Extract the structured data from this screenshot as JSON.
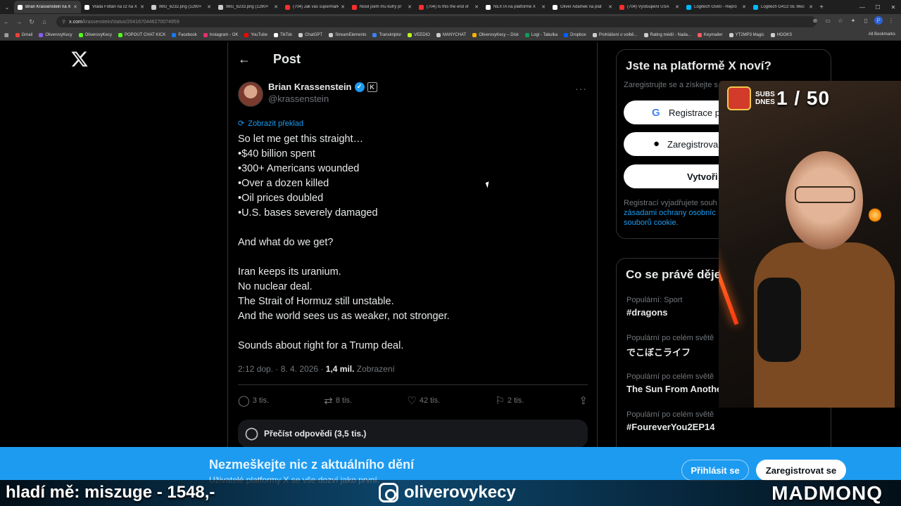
{
  "browser": {
    "tabs": [
      {
        "title": "Brian Krassenstein na X",
        "color": "#ffffff",
        "active": true
      },
      {
        "title": "Vláda Foltán na cz na X",
        "color": "#ffffff",
        "active": false
      },
      {
        "title": "IMG_6232.png (1290×",
        "color": "#cccccc",
        "active": false
      },
      {
        "title": "IMG_6233.png (1290×",
        "color": "#cccccc",
        "active": false
      },
      {
        "title": "(704) Jak vás supermark",
        "color": "#ff2d2d",
        "active": false
      },
      {
        "title": "Nosil jsem mu kufry pr",
        "color": "#ff2d2d",
        "active": false
      },
      {
        "title": "(704) Is this the end of",
        "color": "#ff2d2d",
        "active": false
      },
      {
        "title": "NEXTA na platformě X",
        "color": "#ffffff",
        "active": false
      },
      {
        "title": "Oliver Adámek na plat",
        "color": "#ffffff",
        "active": false
      },
      {
        "title": "(704) Vystoupení USA",
        "color": "#ff2d2d",
        "active": false
      },
      {
        "title": "Logitech G560 - Repro",
        "color": "#00b8fc",
        "active": false
      },
      {
        "title": "Logitech G413 SE Mec",
        "color": "#00b8fc",
        "active": false
      }
    ],
    "new_tab": "+",
    "url_host": "x.com",
    "url_path": "/krassenstein/status/2041670446270074959",
    "profile_letter": "P",
    "bookmarks": [
      {
        "label": "Gmail",
        "color": "#ea4335"
      },
      {
        "label": "OliverovyKecy",
        "color": "#8a5cf6"
      },
      {
        "label": "OliverovyKecy",
        "color": "#53fc18"
      },
      {
        "label": "POPOUT CHAT KICK",
        "color": "#53fc18"
      },
      {
        "label": "Facebook",
        "color": "#1877f2"
      },
      {
        "label": "Instagram - OK",
        "color": "#e1306c"
      },
      {
        "label": "YouTube",
        "color": "#ff0000"
      },
      {
        "label": "TikTok",
        "color": "#ffffff"
      },
      {
        "label": "ChatGPT",
        "color": "#cccccc"
      },
      {
        "label": "StreamElements",
        "color": "#cccccc"
      },
      {
        "label": "Transkriptor",
        "color": "#3b82f6"
      },
      {
        "label": "VEEDIO",
        "color": "#b9f227"
      },
      {
        "label": "MANYCHAT",
        "color": "#cccccc"
      },
      {
        "label": "OliverovyKecy – Disk",
        "color": "#f4b400"
      },
      {
        "label": "Logi - Tabulka",
        "color": "#0f9d58"
      },
      {
        "label": "Dropbox",
        "color": "#0061ff"
      },
      {
        "label": "Prohlášení o volbě...",
        "color": "#cccccc"
      },
      {
        "label": "Rating médií - Nada...",
        "color": "#cccccc"
      },
      {
        "label": "Keymailer",
        "color": "#ff5a5f"
      },
      {
        "label": "YT2MP3 Magic",
        "color": "#cccccc"
      },
      {
        "label": "HOOKS",
        "color": "#cccccc"
      }
    ],
    "all_bookmarks": "All Bookmarks"
  },
  "post": {
    "header_title": "Post",
    "author_name": "Brian Krassenstein",
    "author_handle": "@krassenstein",
    "affiliate_badge": "K",
    "translate_label": "Zobrazit překlad",
    "lines": [
      "So let me get this straight…",
      "•$40 billion spent",
      "•300+ Americans wounded",
      "•Over a dozen killed",
      "•Oil prices doubled",
      "•U.S. bases severely damaged",
      "",
      "And what do we get?",
      "",
      "Iran keeps its uranium.",
      "No nuclear deal.",
      "The Strait of Hormuz still unstable.",
      "And the world sees us as weaker, not stronger.",
      "",
      "Sounds about right for a Trump deal."
    ],
    "timestamp": "2:12 dop. · 8. 4. 2026 ·",
    "views_count": "1,4 mil.",
    "views_label": "Zobrazení",
    "replies": "3 tis.",
    "reposts": "8 tis.",
    "likes": "42 tis.",
    "bookmarks": "2 tis.",
    "read_replies": "Přečíst odpovědi (3,5 tis.)"
  },
  "sidebar": {
    "signup": {
      "title": "Jste na platformě X noví?",
      "subtitle": "Zaregistrujte se a získejte s",
      "google_btn": "Registrace p",
      "apple_btn": "Zaregistrova",
      "create_btn": "Vytvoři",
      "legal_prefix": "Registrací vyjadřujete souh",
      "legal_link1": "zásadami ochrany osobníc",
      "legal_link2": "souborů cookie."
    },
    "trends": {
      "title": "Co se právě děje",
      "items": [
        {
          "context": "Populární: Sport",
          "name": "#dragons"
        },
        {
          "context": "Populární po celém světě",
          "name": "でこぼこライフ"
        },
        {
          "context": "Populární po celém světě",
          "name": "The Sun From Anothe"
        },
        {
          "context": "Populární po celém světě",
          "name": "#FoureverYou2EP14"
        }
      ]
    }
  },
  "banner": {
    "title": "Nezmeškejte nic z aktuálního dění",
    "subtitle": "Uživatelé platformy X se vše dozví jako první.",
    "login": "Přihlásit se",
    "register": "Zaregistrovat se"
  },
  "stream": {
    "subs_label_line1": "SUBS",
    "subs_label_line2": "DNES",
    "subs_count": "1 / 50",
    "ticker": "hladí mě: miszuge - 1548,-",
    "instagram": "oliverovykecy",
    "brand": "MADMONQ"
  },
  "colors": {
    "accent": "#1d9bf0",
    "background": "#000000",
    "text": "#e7e9ea",
    "muted": "#71767b"
  }
}
